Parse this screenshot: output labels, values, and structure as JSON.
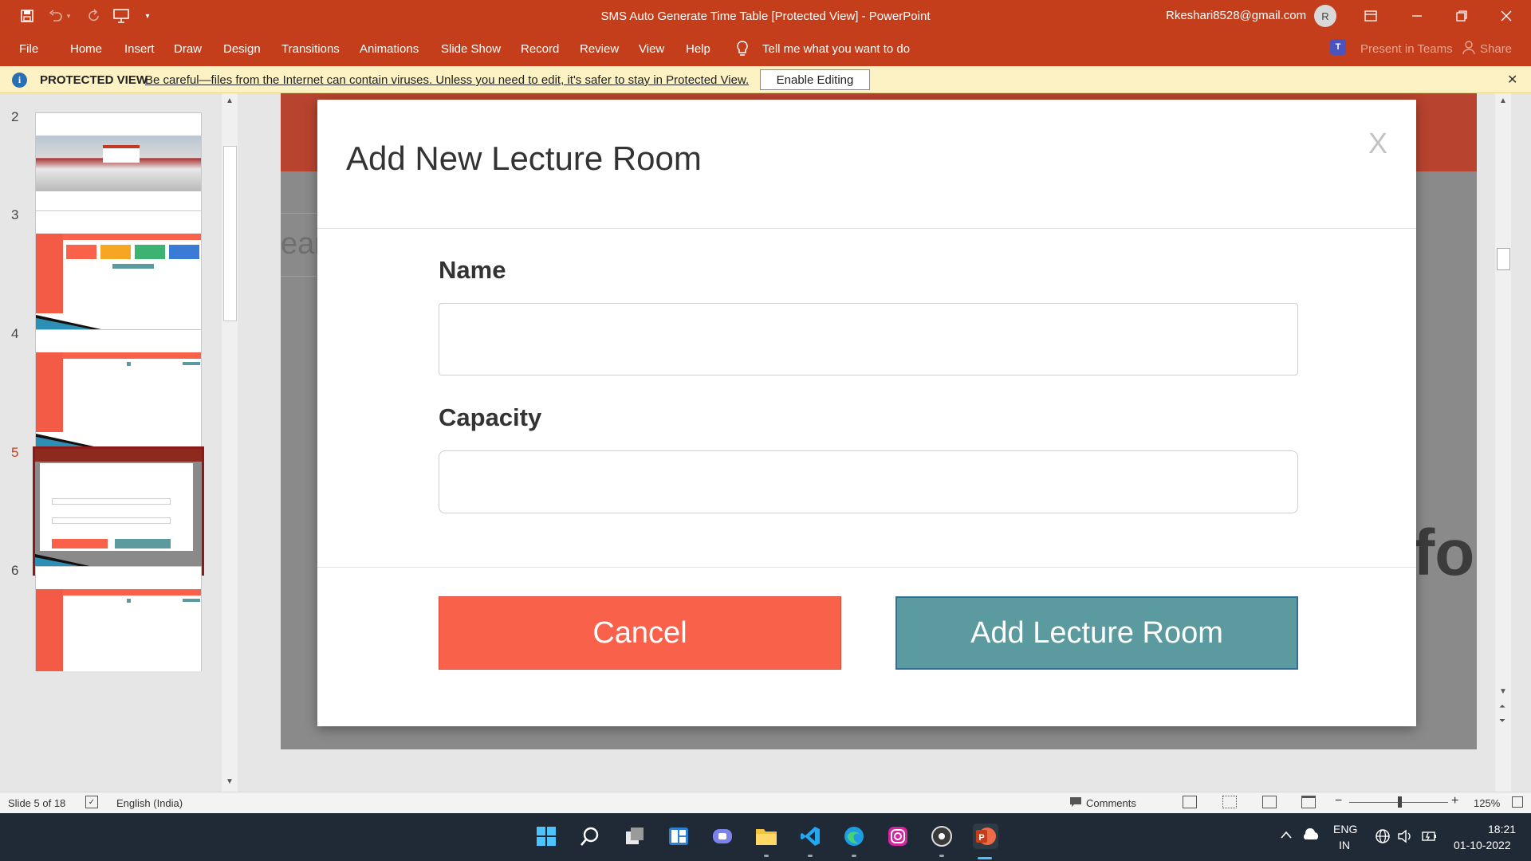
{
  "window": {
    "title": "SMS Auto Generate Time Table [Protected View]  -  PowerPoint",
    "account_email": "Rkeshari8528@gmail.com",
    "avatar_initial": "R"
  },
  "ribbon": {
    "tabs": [
      "File",
      "Home",
      "Insert",
      "Draw",
      "Design",
      "Transitions",
      "Animations",
      "Slide Show",
      "Record",
      "Review",
      "View",
      "Help"
    ],
    "tell_me": "Tell me what you want to do",
    "present_in_teams": "Present in Teams",
    "share": "Share",
    "teams_badge": "T"
  },
  "protected_view": {
    "label": "PROTECTED VIEW",
    "message": "Be careful—files from the Internet can contain viruses. Unless you need to edit, it's safer to stay in Protected View.",
    "enable_button": "Enable Editing",
    "info_glyph": "i",
    "close_glyph": "✕"
  },
  "thumbnails": {
    "numbers": [
      "2",
      "3",
      "4",
      "5",
      "6"
    ],
    "selected_index": 3
  },
  "slide": {
    "bg_text_left": "ear",
    "bg_text_right": "fo",
    "modal": {
      "title": "Add New Lecture Room",
      "close_glyph": "X",
      "name_label": "Name",
      "name_value": "",
      "capacity_label": "Capacity",
      "capacity_value": "",
      "cancel_button": "Cancel",
      "add_button": "Add Lecture Room"
    }
  },
  "statusbar": {
    "slide_info": "Slide 5 of 18",
    "language": "English (India)",
    "comments": "Comments",
    "zoom": "125%"
  },
  "taskbar": {
    "icons": [
      "windows-start-icon",
      "search-icon",
      "task-view-icon",
      "widgets-icon",
      "teams-chat-icon",
      "file-explorer-icon",
      "vscode-icon",
      "edge-icon",
      "instagram-icon",
      "media-player-icon",
      "powerpoint-icon"
    ],
    "tray_lang_1": "ENG",
    "tray_lang_2": "IN",
    "time": "18:21",
    "date": "01-10-2022"
  },
  "colors": {
    "accent": "#c43e1c",
    "cancel": "#fa614b",
    "add": "#5b9b9f"
  }
}
